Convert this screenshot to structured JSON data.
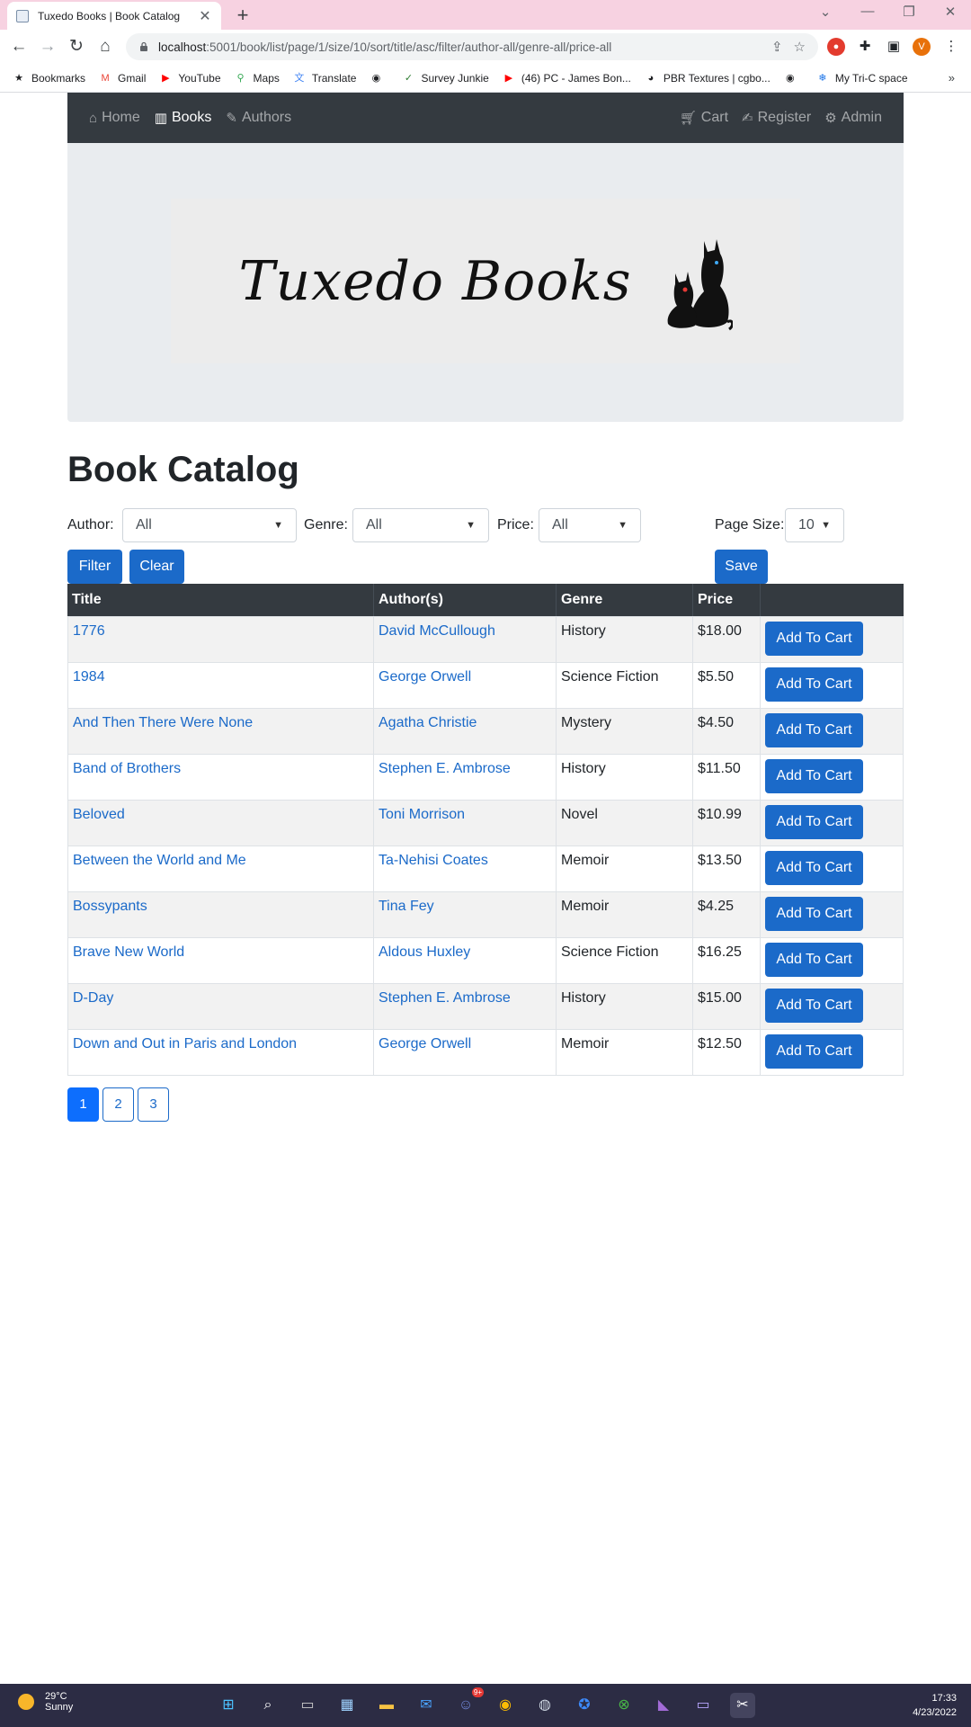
{
  "browser": {
    "tab_title": "Tuxedo Books | Book Catalog",
    "tab_close": "✕",
    "new_tab": "+",
    "url_host": "localhost",
    "url_path": ":5001/book/list/page/1/size/10/sort/title/asc/filter/author-all/genre-all/price-all",
    "profile_initial": "V",
    "bookmarks": [
      {
        "label": "Bookmarks",
        "icon": "star-icon",
        "color": "#202124"
      },
      {
        "label": "Gmail",
        "icon": "gmail-icon",
        "color": "#ea4335"
      },
      {
        "label": "YouTube",
        "icon": "youtube-icon",
        "color": "#ff0000"
      },
      {
        "label": "Maps",
        "icon": "maps-icon",
        "color": "#34a853"
      },
      {
        "label": "Translate",
        "icon": "translate-icon",
        "color": "#4285f4"
      },
      {
        "label": "",
        "icon": "globe-icon",
        "color": "#202124"
      },
      {
        "label": "Survey Junkie",
        "icon": "check-icon",
        "color": "#2e7d32"
      },
      {
        "label": "(46) PC - James Bon...",
        "icon": "youtube-icon",
        "color": "#ff0000"
      },
      {
        "label": "PBR Textures | cgbo...",
        "icon": "palette-icon",
        "color": "#202124"
      },
      {
        "label": "",
        "icon": "globe-icon",
        "color": "#202124"
      },
      {
        "label": "My Tri-C space",
        "icon": "snowflake-icon",
        "color": "#1a73e8"
      }
    ],
    "bookmarks_more": "»"
  },
  "nav": {
    "home": "Home",
    "books": "Books",
    "authors": "Authors",
    "cart": "Cart",
    "register": "Register",
    "admin": "Admin"
  },
  "banner": {
    "logo_text": "Tuxedo Books"
  },
  "page": {
    "title": "Book Catalog"
  },
  "filters": {
    "author_label": "Author:",
    "author_value": "All",
    "genre_label": "Genre:",
    "genre_value": "All",
    "price_label": "Price:",
    "price_value": "All",
    "page_size_label": "Page Size:",
    "page_size_value": "10",
    "filter_button": "Filter",
    "clear_button": "Clear",
    "save_button": "Save"
  },
  "table": {
    "headers": [
      "Title",
      "Author(s)",
      "Genre",
      "Price",
      ""
    ],
    "action_label": "Add To Cart",
    "rows": [
      {
        "title": "1776",
        "author": "David McCullough",
        "genre": "History",
        "price": "$18.00"
      },
      {
        "title": "1984",
        "author": "George Orwell",
        "genre": "Science Fiction",
        "price": "$5.50"
      },
      {
        "title": "And Then There Were None",
        "author": "Agatha Christie",
        "genre": "Mystery",
        "price": "$4.50"
      },
      {
        "title": "Band of Brothers",
        "author": "Stephen E. Ambrose",
        "genre": "History",
        "price": "$11.50"
      },
      {
        "title": "Beloved",
        "author": "Toni Morrison",
        "genre": "Novel",
        "price": "$10.99"
      },
      {
        "title": "Between the World and Me",
        "author": "Ta-Nehisi Coates",
        "genre": "Memoir",
        "price": "$13.50"
      },
      {
        "title": "Bossypants",
        "author": "Tina Fey",
        "genre": "Memoir",
        "price": "$4.25"
      },
      {
        "title": "Brave New World",
        "author": "Aldous Huxley",
        "genre": "Science Fiction",
        "price": "$16.25"
      },
      {
        "title": "D-Day",
        "author": "Stephen E. Ambrose",
        "genre": "History",
        "price": "$15.00"
      },
      {
        "title": "Down and Out in Paris and London",
        "author": "George Orwell",
        "genre": "Memoir",
        "price": "$12.50"
      }
    ]
  },
  "pagination": {
    "pages": [
      "1",
      "2",
      "3"
    ],
    "current": "1"
  },
  "taskbar": {
    "temperature": "29°C",
    "condition": "Sunny",
    "time": "17:33",
    "date": "4/23/2022",
    "discord_badge": "9+"
  },
  "colors": {
    "primary": "#1b6ac9",
    "navbar": "#343a40",
    "tab_bar": "#f7d2e1",
    "jumbotron": "#e9ecef"
  }
}
